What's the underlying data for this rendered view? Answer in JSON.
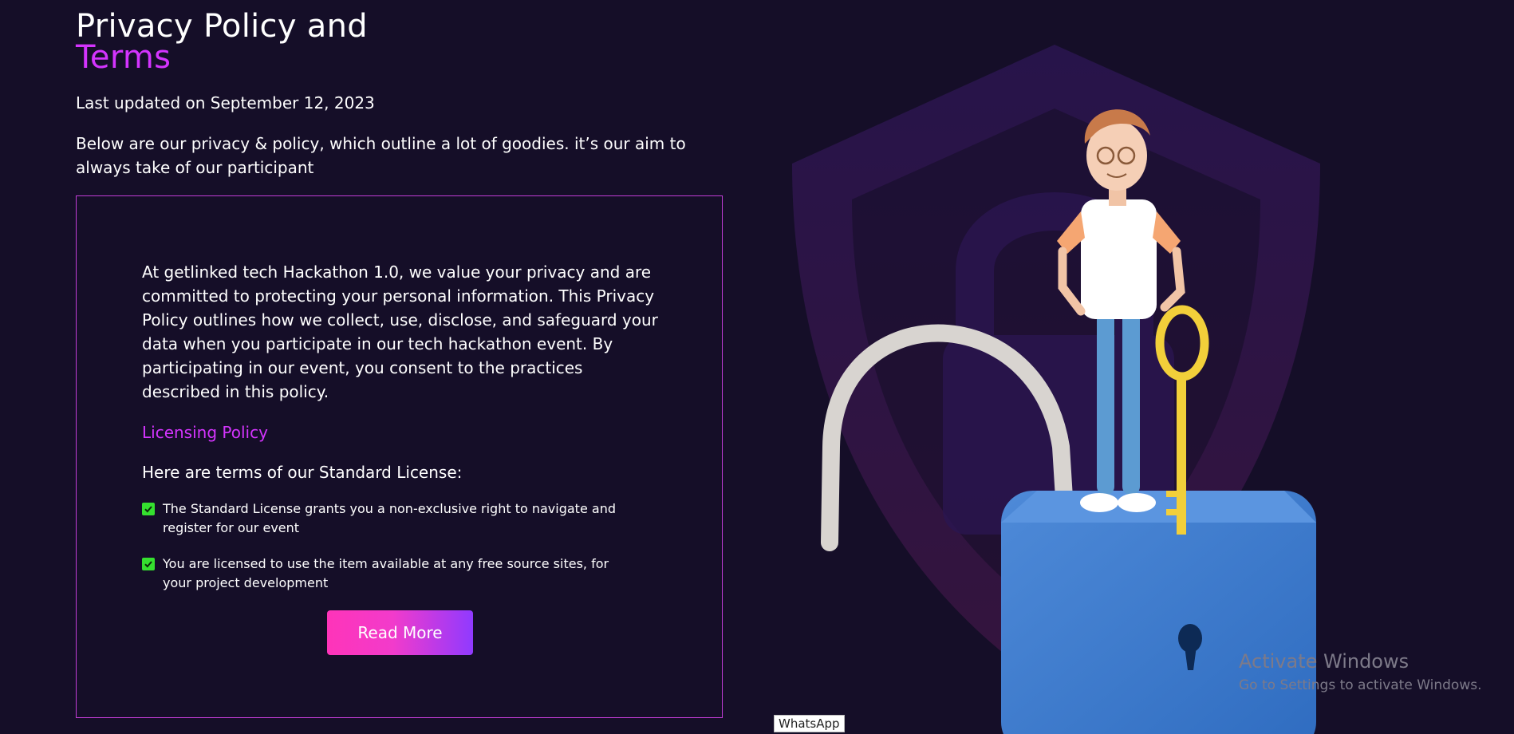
{
  "header": {
    "title_line1": "Privacy Policy and",
    "title_line2": "Terms",
    "updated": "Last updated on September 12, 2023",
    "intro": "Below are our privacy & policy, which outline a lot of goodies. it’s our aim to always take of our participant"
  },
  "card": {
    "lead": "At getlinked tech Hackathon 1.0, we value your privacy and are committed to protecting your personal information. This Privacy Policy outlines how we collect, use, disclose, and safeguard your data when you participate in our tech hackathon event. By participating in our event, you consent to the practices described in this policy.",
    "policy_heading": "Licensing Policy",
    "terms_intro": "Here are terms of our Standard License:",
    "terms": [
      "The Standard License grants you a non-exclusive right to navigate and register for our event",
      "You are licensed to use the item available at any free source sites, for your project development"
    ],
    "button_label": "Read More"
  },
  "colors": {
    "background": "#150e28",
    "accent": "#d434fe",
    "check": "#35e02f",
    "button_start": "#fe34b9",
    "button_end": "#903aff"
  },
  "icons": {
    "term_check": "checkbox-checked-icon",
    "illustration": "padlock-person-key-illustration"
  },
  "system": {
    "watermark_title": "Activate Windows",
    "watermark_sub": "Go to Settings to activate Windows.",
    "tooltip": "WhatsApp"
  }
}
